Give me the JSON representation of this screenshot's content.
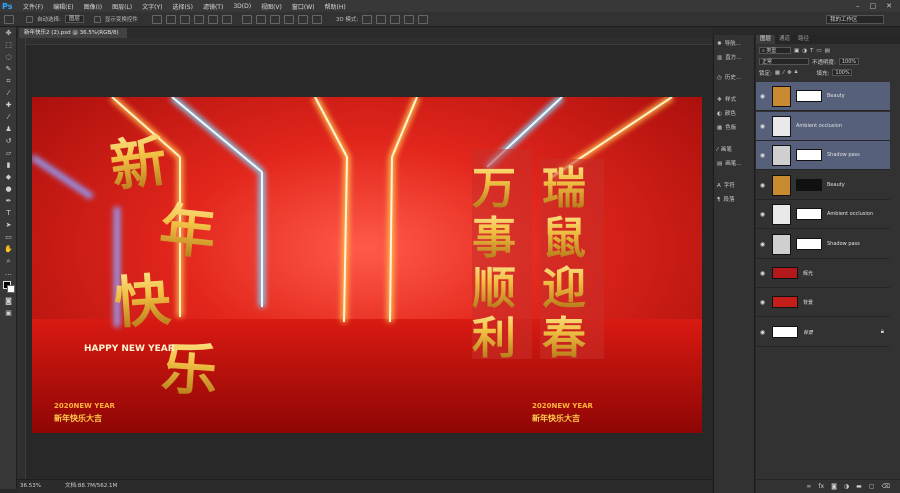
{
  "menu": {
    "logo": "Ps",
    "items": [
      "文件(F)",
      "编辑(E)",
      "图像(I)",
      "图层(L)",
      "文字(Y)",
      "选择(S)",
      "滤镜(T)",
      "3D(D)",
      "视图(V)",
      "窗口(W)",
      "帮助(H)"
    ],
    "controls": [
      "–",
      "□",
      "✕"
    ]
  },
  "options": {
    "auto_select": "自动选择:",
    "auto_select_value": "图层",
    "show_transform": "显示变换控件",
    "mode_3d": "3D 模式:",
    "workspace": "我的工作区"
  },
  "document": {
    "tab": "新年快乐2 (2).psd @ 36.5%(RGB/8)",
    "tab_close": "×",
    "zoom": "36.53%",
    "doc_size": "文档:88.7M/562.1M"
  },
  "panel_icons": [
    {
      "icon": "nav-icon",
      "label": "导航..."
    },
    {
      "icon": "histogram-icon",
      "label": "直方..."
    },
    {
      "icon": "history-icon",
      "label": "历史..."
    },
    {
      "icon": "swatches-icon",
      "label": "样式"
    },
    {
      "icon": "color-icon",
      "label": "颜色"
    },
    {
      "icon": "adjust-icon",
      "label": "色板"
    },
    {
      "icon": "brush-icon",
      "label": "画笔"
    },
    {
      "icon": "brush-preset-icon",
      "label": "画笔..."
    },
    {
      "icon": "char-icon",
      "label": "字符"
    },
    {
      "icon": "para-icon",
      "label": "段落"
    }
  ],
  "layers_panel": {
    "tabs": [
      "图层",
      "通道",
      "路径"
    ],
    "kind_filter": "类型",
    "blend_mode": "正常",
    "opacity_label": "不透明度:",
    "opacity": "100%",
    "lock_label": "锁定:",
    "fill_label": "填充:",
    "fill": "100%",
    "layers": [
      {
        "name": "Beauty",
        "selected": true,
        "has_mask": true
      },
      {
        "name": "Ambient occlusion",
        "selected": true,
        "has_mask": false
      },
      {
        "name": "Shadow pass",
        "selected": true,
        "has_mask": true
      },
      {
        "name": "Beauty",
        "selected": false,
        "has_mask": true
      },
      {
        "name": "Ambient occlusion",
        "selected": false,
        "has_mask": true
      },
      {
        "name": "Shadow pass",
        "selected": false,
        "has_mask": true
      },
      {
        "name": "辉光",
        "selected": false,
        "has_mask": false
      },
      {
        "name": "背景",
        "selected": false,
        "has_mask": false
      },
      {
        "name": "背景",
        "selected": false,
        "has_mask": false
      }
    ],
    "bottom_icons": [
      "link-icon",
      "fx-icon",
      "mask-icon",
      "adjust-icon",
      "folder-icon",
      "new-layer-icon",
      "trash-icon"
    ]
  },
  "artwork": {
    "left_chars": [
      "新",
      "年",
      "快",
      "乐"
    ],
    "right_col1": [
      "万",
      "事",
      "顺",
      "利"
    ],
    "right_col2": [
      "瑞",
      "鼠",
      "迎",
      "春"
    ],
    "happy_new_year": "HAPPY NEW YEAR",
    "floor_texts": [
      "2020NEW YEAR",
      "新年快乐大吉"
    ]
  }
}
